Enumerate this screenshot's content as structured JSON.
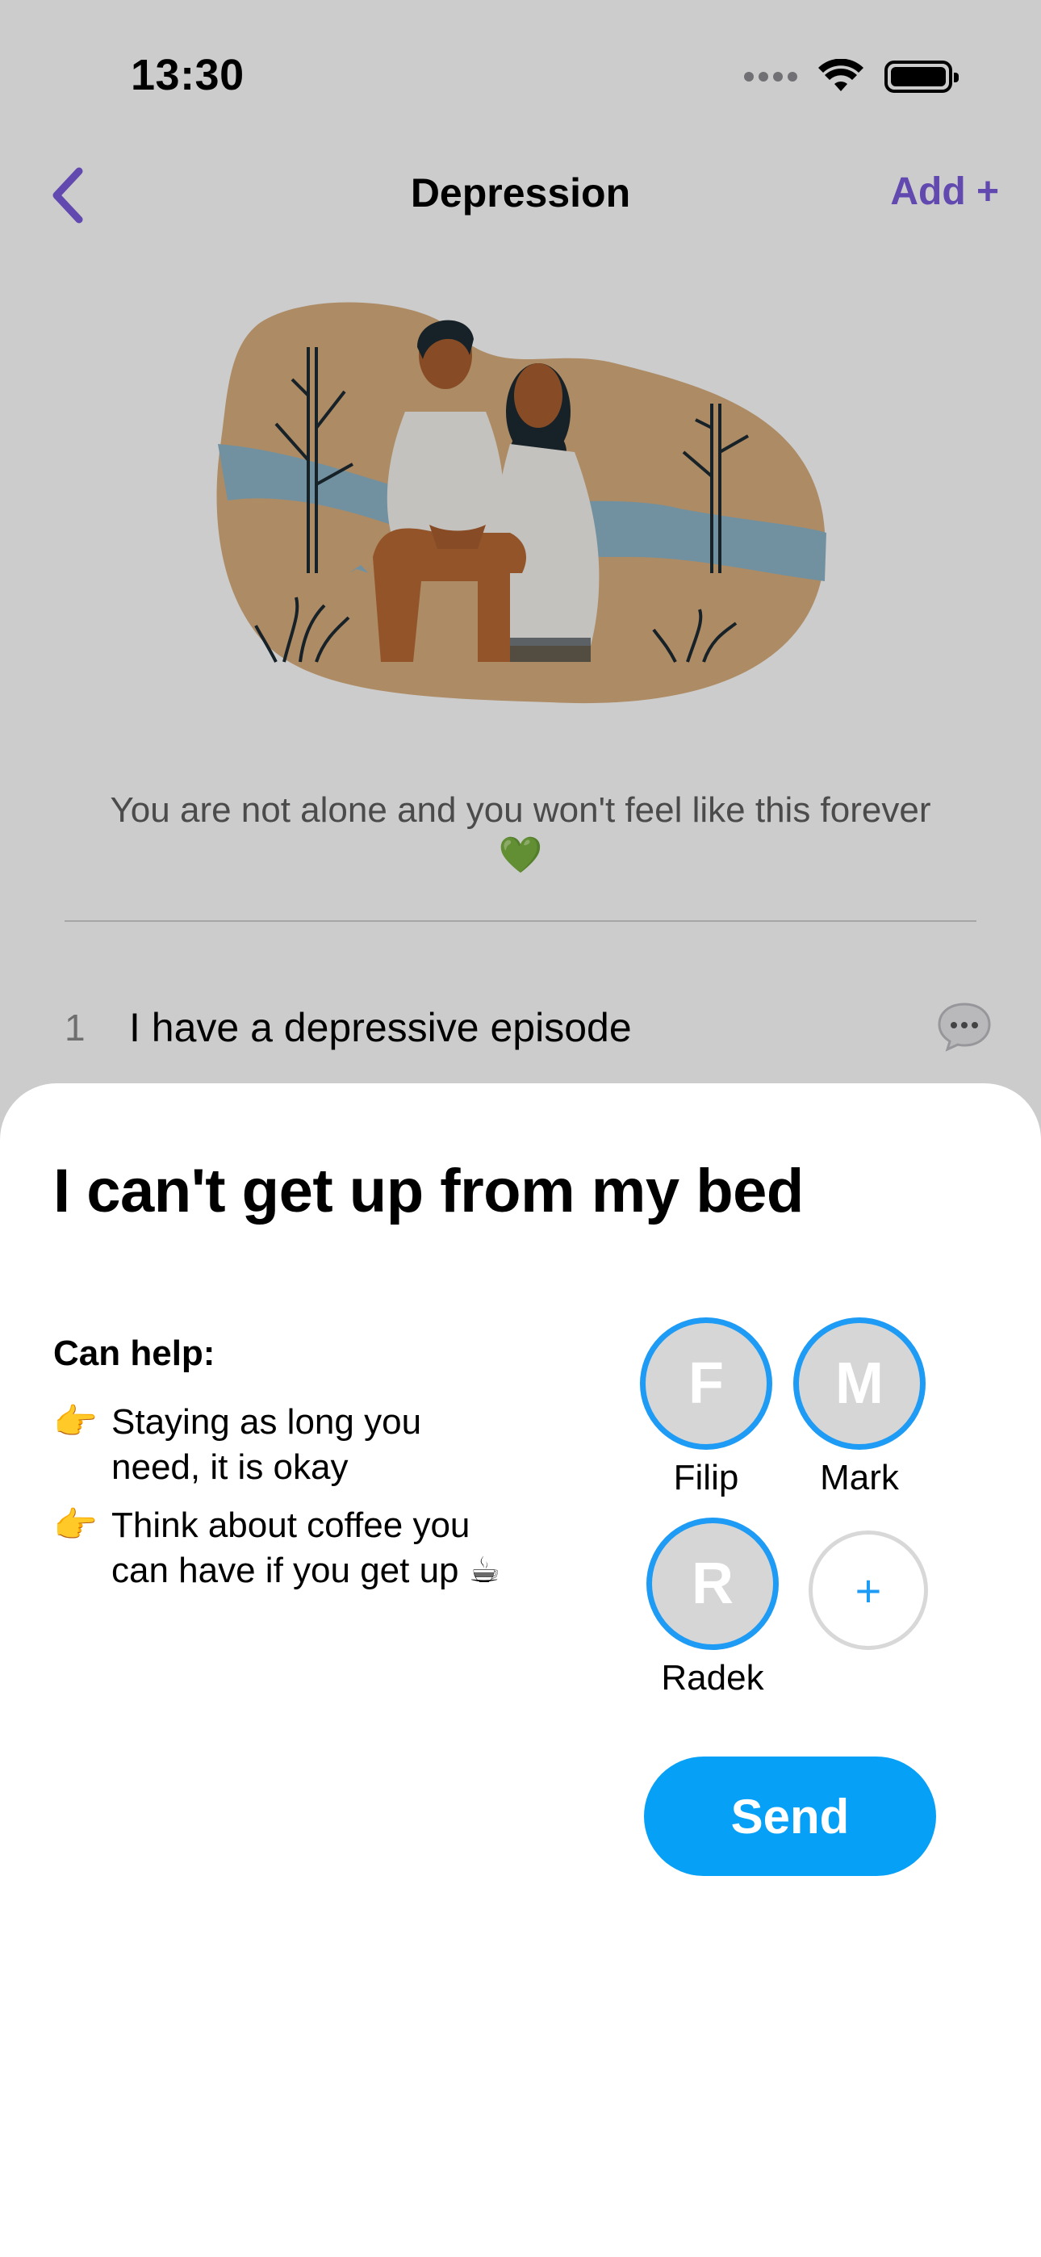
{
  "status_bar": {
    "time": "13:30"
  },
  "nav": {
    "title": "Depression",
    "add_label": "Add +"
  },
  "quote": "You are not alone and you won't feel like this forever 💚",
  "list": [
    {
      "number": "1",
      "text": "I have a depressive episode"
    }
  ],
  "sheet": {
    "title": "I can't get up from my bed",
    "help_heading": "Can help:",
    "help_items": [
      {
        "bullet": "👉",
        "text": "Staying as long you need, it is okay"
      },
      {
        "bullet": "👉",
        "text": "Think about coffee you can have if you get up ☕"
      }
    ],
    "contacts": [
      {
        "initial": "F",
        "name": "Filip"
      },
      {
        "initial": "M",
        "name": "Mark"
      },
      {
        "initial": "R",
        "name": "Radek"
      }
    ],
    "add_contact_symbol": "+",
    "send_label": "Send"
  },
  "colors": {
    "accent_purple": "#7a5cdb",
    "accent_blue": "#07a0f7",
    "avatar_ring": "#1e9bf5"
  }
}
